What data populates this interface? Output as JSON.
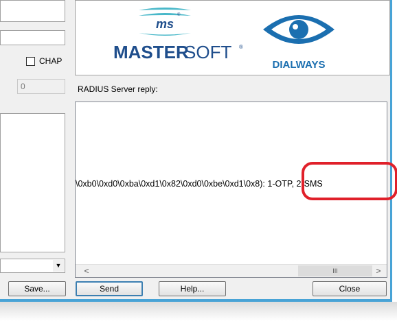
{
  "left_panel": {
    "chap_label": "CHAP",
    "number_field_value": "0"
  },
  "logos": {
    "ms_badge_text": "ms",
    "mastersoft_text_bold": "MASTER",
    "mastersoft_text_thin": "SOFT",
    "registered_mark": "®",
    "dialways_text": "DIALWAYS"
  },
  "reply": {
    "label": "RADIUS Server reply:",
    "text": "\\0xb0\\0xd0\\0xba\\0xd1\\0x82\\0xd0\\0xbe\\0xd1\\0x8",
    "text_tail": "): 1-OTP, 2-SMS",
    "scroll_thumb_grip": "III",
    "scroll_left_glyph": "<",
    "scroll_right_glyph": ">"
  },
  "buttons": {
    "save": "Save...",
    "send": "Send",
    "help": "Help...",
    "close": "Close"
  },
  "colors": {
    "window_border": "#48a3d6",
    "annotation": "#e0202a",
    "mastersoft_blue": "#1f4e8c",
    "dialways_blue": "#1b6fb0"
  }
}
